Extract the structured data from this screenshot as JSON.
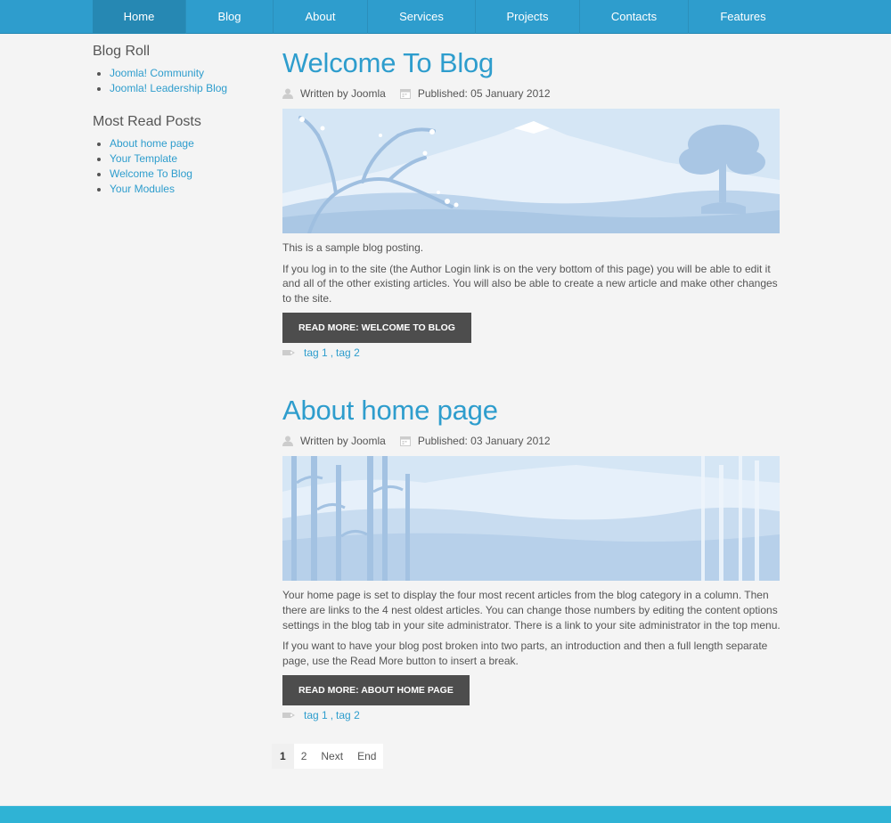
{
  "nav": {
    "items": [
      {
        "label": "Home",
        "active": true
      },
      {
        "label": "Blog"
      },
      {
        "label": "About"
      },
      {
        "label": "Services"
      },
      {
        "label": "Projects"
      },
      {
        "label": "Contacts"
      },
      {
        "label": "Features"
      }
    ]
  },
  "sidebar": {
    "blog_roll": {
      "title": "Blog Roll",
      "links": [
        "Joomla! Community",
        "Joomla! Leadership Blog"
      ]
    },
    "most_read": {
      "title": "Most Read Posts",
      "links": [
        "About home page",
        "Your Template",
        "Welcome To Blog",
        "Your Modules"
      ]
    }
  },
  "articles": [
    {
      "title": "Welcome To Blog",
      "author": "Written by Joomla",
      "published": "Published: 05 January 2012",
      "paragraphs": [
        "This is a sample blog posting.",
        "If you log in to the site (the Author Login link is on the very bottom of this page) you will be able to edit it and all of the other existing articles. You will also be able to create a new article and make other changes to the site."
      ],
      "readmore": "Read more: Welcome To Blog",
      "tags": [
        "tag 1",
        "tag 2"
      ],
      "tag_separator": ","
    },
    {
      "title": "About home page",
      "author": "Written by Joomla",
      "published": "Published: 03 January 2012",
      "paragraphs": [
        "Your home page is set to display the four most recent articles from the blog category in a column. Then there are links to the 4 nest oldest articles. You can change those numbers by editing the content options settings in the blog tab in your site administrator. There is a link to your site administrator in the top menu.",
        "If you want to have your blog post broken into two parts, an introduction and then a full length separate page, use the Read More button to insert a break."
      ],
      "readmore": "Read more: About home page",
      "tags": [
        "tag 1",
        "tag 2"
      ],
      "tag_separator": ","
    }
  ],
  "pagination": {
    "items": [
      "1",
      "2",
      "Next",
      "End"
    ],
    "current": "1"
  },
  "icons": {
    "author": "user-icon",
    "published": "calendar-icon",
    "tags": "tag-icon"
  },
  "colors": {
    "accent": "#2e9dcd",
    "nav_active": "#2688b3",
    "button": "#4d4d4d",
    "footer": "#2fb3d5",
    "background": "#f4f4f4"
  }
}
